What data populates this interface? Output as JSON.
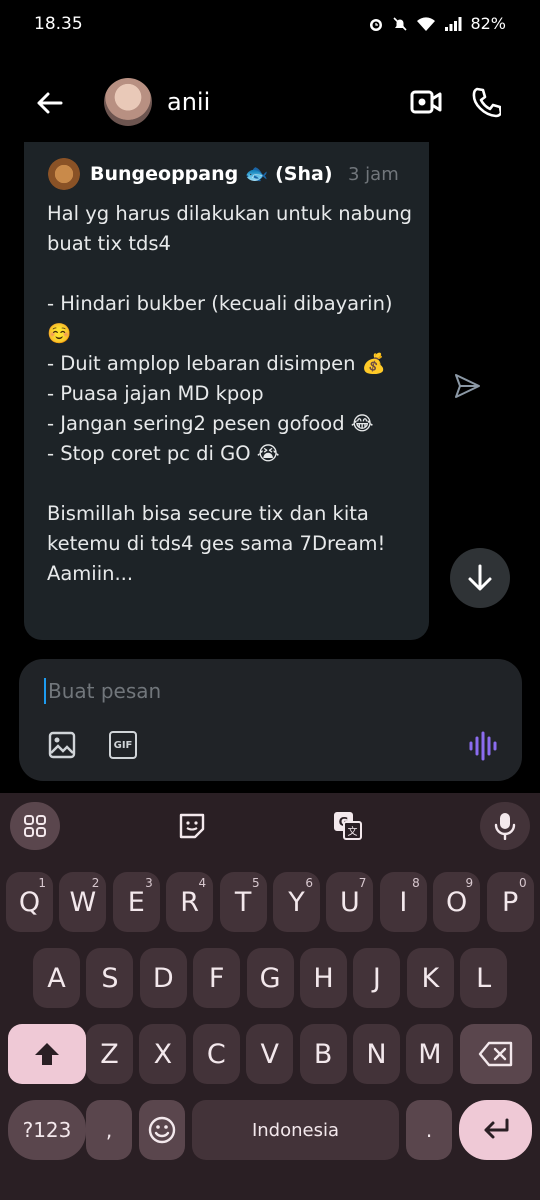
{
  "status": {
    "time": "18.35",
    "battery": "82%"
  },
  "header": {
    "contact_name": "anii"
  },
  "quoted": {
    "author": "Bungeoppang 🐟 (Sha)",
    "time": "3 jam",
    "text": "Hal yg harus dilakukan untuk nabung buat tix tds4\n\n- Hindari bukber (kecuali dibayarin) ☺️\n- Duit amplop lebaran disimpen 💰\n- Puasa jajan MD kpop\n- Jangan sering2 pesen gofood 😂\n- Stop coret pc di GO 😭\n\nBismillah bisa secure tix dan kita ketemu di tds4 ges sama 7Dream! Aamiin..."
  },
  "composer": {
    "placeholder": "Buat pesan",
    "gif_label": "GIF"
  },
  "keyboard": {
    "row1": [
      {
        "k": "Q",
        "n": "1"
      },
      {
        "k": "W",
        "n": "2"
      },
      {
        "k": "E",
        "n": "3"
      },
      {
        "k": "R",
        "n": "4"
      },
      {
        "k": "T",
        "n": "5"
      },
      {
        "k": "Y",
        "n": "6"
      },
      {
        "k": "U",
        "n": "7"
      },
      {
        "k": "I",
        "n": "8"
      },
      {
        "k": "O",
        "n": "9"
      },
      {
        "k": "P",
        "n": "0"
      }
    ],
    "row2": [
      "A",
      "S",
      "D",
      "F",
      "G",
      "H",
      "J",
      "K",
      "L"
    ],
    "row3": [
      "Z",
      "X",
      "C",
      "V",
      "B",
      "N",
      "M"
    ],
    "symbols_label": "?123",
    "comma": ",",
    "space_label": "Indonesia",
    "period": "."
  }
}
